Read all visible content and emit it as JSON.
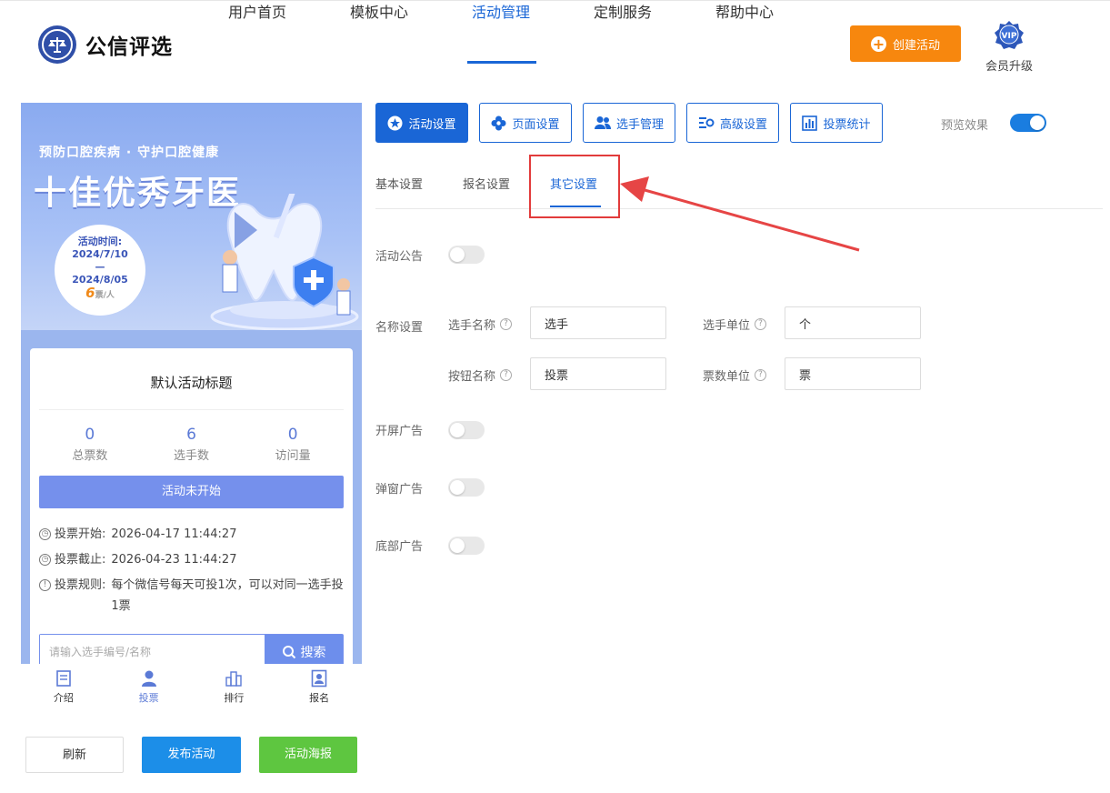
{
  "brand": {
    "name": "公信评选"
  },
  "nav": {
    "items": [
      {
        "label": "用户首页",
        "active": false
      },
      {
        "label": "模板中心",
        "active": false
      },
      {
        "label": "活动管理",
        "active": true
      },
      {
        "label": "定制服务",
        "active": false
      },
      {
        "label": "帮助中心",
        "active": false
      }
    ],
    "create_label": "创建活动",
    "vip_badge": "VIP",
    "vip_label": "会员升级"
  },
  "preview": {
    "banner_subtitle": "预防口腔疾病 · 守护口腔健康",
    "banner_title": "十佳优秀牙医",
    "date_label": "活动时间:",
    "date_start": "2024/7/10",
    "date_sep": "—",
    "date_end": "2024/8/05",
    "price_num": "6",
    "price_unit": "票/人",
    "card_title": "默认活动标题",
    "stats": [
      {
        "value": "0",
        "label": "总票数"
      },
      {
        "value": "6",
        "label": "选手数"
      },
      {
        "value": "0",
        "label": "访问量"
      }
    ],
    "status_button": "活动未开始",
    "vote_start_label": "投票开始:",
    "vote_start_value": "2026-04-17 11:44:27",
    "vote_end_label": "投票截止:",
    "vote_end_value": "2026-04-23 11:44:27",
    "rule_label": "投票规则:",
    "rule_value": "每个微信号每天可投1次，可以对同一选手投1票",
    "search_placeholder": "请输入选手编号/名称",
    "search_button": "搜索",
    "tabs": [
      {
        "label": "介绍",
        "icon": "doc-icon",
        "active": false
      },
      {
        "label": "投票",
        "icon": "person-icon",
        "active": true
      },
      {
        "label": "排行",
        "icon": "bar-chart-icon",
        "active": false
      },
      {
        "label": "报名",
        "icon": "id-card-icon",
        "active": false
      }
    ]
  },
  "actions": {
    "refresh": "刷新",
    "publish": "发布活动",
    "poster": "活动海报"
  },
  "tools": [
    {
      "label": "活动设置",
      "icon": "star-icon",
      "active": true
    },
    {
      "label": "页面设置",
      "icon": "flower-icon",
      "active": false
    },
    {
      "label": "选手管理",
      "icon": "users-icon",
      "active": false
    },
    {
      "label": "高级设置",
      "icon": "sliders-icon",
      "active": false
    },
    {
      "label": "投票统计",
      "icon": "stats-icon",
      "active": false
    }
  ],
  "preview_toggle": {
    "label": "预览效果",
    "on": true
  },
  "subtabs": [
    {
      "label": "基本设置",
      "active": false
    },
    {
      "label": "报名设置",
      "active": false
    },
    {
      "label": "其它设置",
      "active": true
    }
  ],
  "settings": {
    "announcement_label": "活动公告",
    "announcement_on": false,
    "names_label": "名称设置",
    "player_name_label": "选手名称",
    "player_name_value": "选手",
    "player_unit_label": "选手单位",
    "player_unit_value": "个",
    "button_name_label": "按钮名称",
    "button_name_value": "投票",
    "vote_unit_label": "票数单位",
    "vote_unit_value": "票",
    "splash_ad_label": "开屏广告",
    "splash_ad_on": false,
    "popup_ad_label": "弹窗广告",
    "popup_ad_on": false,
    "bottom_ad_label": "底部广告",
    "bottom_ad_on": false
  },
  "colors": {
    "primary": "#1a66d6",
    "orange": "#f7870e",
    "green": "#5ec640",
    "publish_blue": "#1c8ee8",
    "highlight_red": "#e23b3b"
  }
}
